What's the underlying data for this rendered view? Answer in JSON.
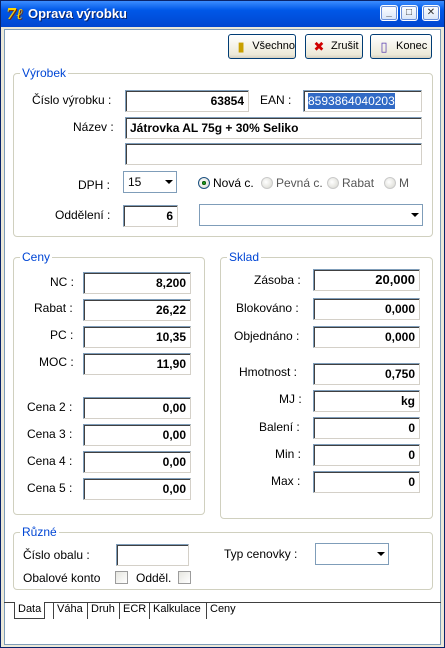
{
  "window": {
    "title": "Oprava výrobku",
    "icon": "app-logo-icon"
  },
  "toolbar": {
    "all_label": "Všechno",
    "cancel_label": "Zrušit",
    "end_label": "Konec"
  },
  "product": {
    "group_title": "Výrobek",
    "number_label": "Číslo výrobku :",
    "number_value": "63854",
    "ean_label": "EAN :",
    "ean_value": "8593864040203",
    "name_label": "Název :",
    "name_value": "Játrovka AL  75g + 30% Seliko",
    "name2_value": "",
    "vat_label": "DPH :",
    "vat_value": "15",
    "radio_new": "Nová c.",
    "radio_fixed": "Pevná c.",
    "radio_discount": "Rabat",
    "radio_m": "M",
    "dept_label": "Oddělení :",
    "dept_value": "6",
    "dept_combo_value": ""
  },
  "prices": {
    "group_title": "Ceny",
    "nc_label": "NC :",
    "nc_value": "8,200",
    "rabat_label": "Rabat :",
    "rabat_value": "26,22",
    "pc_label": "PC :",
    "pc_value": "10,35",
    "moc_label": "MOC :",
    "moc_value": "11,90",
    "c2_label": "Cena 2 :",
    "c2_value": "0,00",
    "c3_label": "Cena 3 :",
    "c3_value": "0,00",
    "c4_label": "Cena 4 :",
    "c4_value": "0,00",
    "c5_label": "Cena 5 :",
    "c5_value": "0,00"
  },
  "stock": {
    "group_title": "Sklad",
    "stock_label": "Zásoba :",
    "stock_value": "20,000",
    "blocked_label": "Blokováno :",
    "blocked_value": "0,000",
    "ordered_label": "Objednáno :",
    "ordered_value": "0,000",
    "weight_label": "Hmotnost :",
    "weight_value": "0,750",
    "unit_label": "MJ :",
    "unit_value": "kg",
    "pack_label": "Balení :",
    "pack_value": "0",
    "min_label": "Min :",
    "min_value": "0",
    "max_label": "Max :",
    "max_value": "0"
  },
  "misc": {
    "group_title": "Různé",
    "pack_no_label": "Číslo obalu :",
    "pack_no_value": "",
    "price_tag_label": "Typ cenovky :",
    "price_tag_value": "",
    "pack_account_label": "Obalové konto",
    "sep_label": "Odděl."
  },
  "tabs": [
    "Data",
    "Váha",
    "Druh",
    "ECR",
    "Kalkulace",
    "Ceny"
  ],
  "colors": {
    "group_title": "#0046d5",
    "selection": "#316ac5",
    "titlebar": "#0058e8"
  }
}
